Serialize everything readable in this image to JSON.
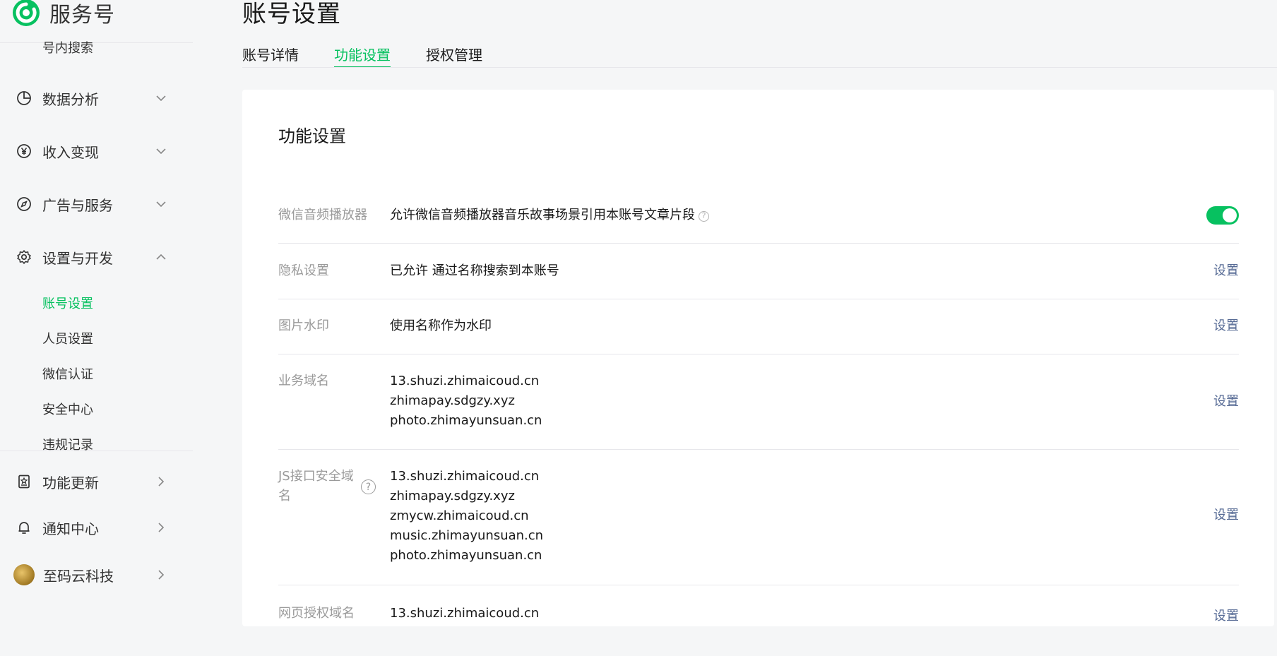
{
  "app": {
    "name": "服务号"
  },
  "sidebar": {
    "cut_item": "号内搜索",
    "groups": [
      {
        "label": "数据分析",
        "icon": "pie-chart-icon"
      },
      {
        "label": "收入变现",
        "icon": "yen-circle-icon"
      },
      {
        "label": "广告与服务",
        "icon": "compass-icon"
      },
      {
        "label": "设置与开发",
        "icon": "gear-icon"
      }
    ],
    "sub_items": [
      "账号设置",
      "人员设置",
      "微信认证",
      "安全中心",
      "违规记录"
    ],
    "bottom": [
      {
        "label": "功能更新",
        "icon": "doc-star-icon"
      },
      {
        "label": "通知中心",
        "icon": "bell-icon"
      },
      {
        "label": "至码云科技",
        "icon": "avatar"
      }
    ]
  },
  "page": {
    "title": "账号设置",
    "tabs": [
      "账号详情",
      "功能设置",
      "授权管理"
    ],
    "active_tab": "功能设置"
  },
  "card": {
    "title": "功能设置",
    "rows": {
      "audio": {
        "label": "微信音频播放器",
        "value": "允许微信音频播放器音乐故事场景引用本账号文章片段",
        "toggle_on": true
      },
      "privacy": {
        "label": "隐私设置",
        "value": "已允许 通过名称搜索到本账号",
        "action": "设置"
      },
      "watermark": {
        "label": "图片水印",
        "value": "使用名称作为水印",
        "action": "设置"
      },
      "biz_domain": {
        "label": "业务域名",
        "domains": [
          "13.shuzi.zhimaicoud.cn",
          "zhimapay.sdgzy.xyz",
          "photo.zhimayunsuan.cn"
        ],
        "action": "设置"
      },
      "js_domain": {
        "label_line1": "JS接口安全域",
        "label_line2": "名",
        "domains": [
          "13.shuzi.zhimaicoud.cn",
          "zhimapay.sdgzy.xyz",
          "zmycw.zhimaicoud.cn",
          "music.zhimayunsuan.cn",
          "photo.zhimayunsuan.cn"
        ],
        "action": "设置"
      },
      "web_domain": {
        "label": "网页授权域名",
        "domains": [
          "13.shuzi.zhimaicoud.cn"
        ],
        "action": "设置"
      }
    }
  },
  "colors": {
    "accent": "#07c160",
    "link": "#576b95",
    "muted": "#9a9a9a"
  }
}
